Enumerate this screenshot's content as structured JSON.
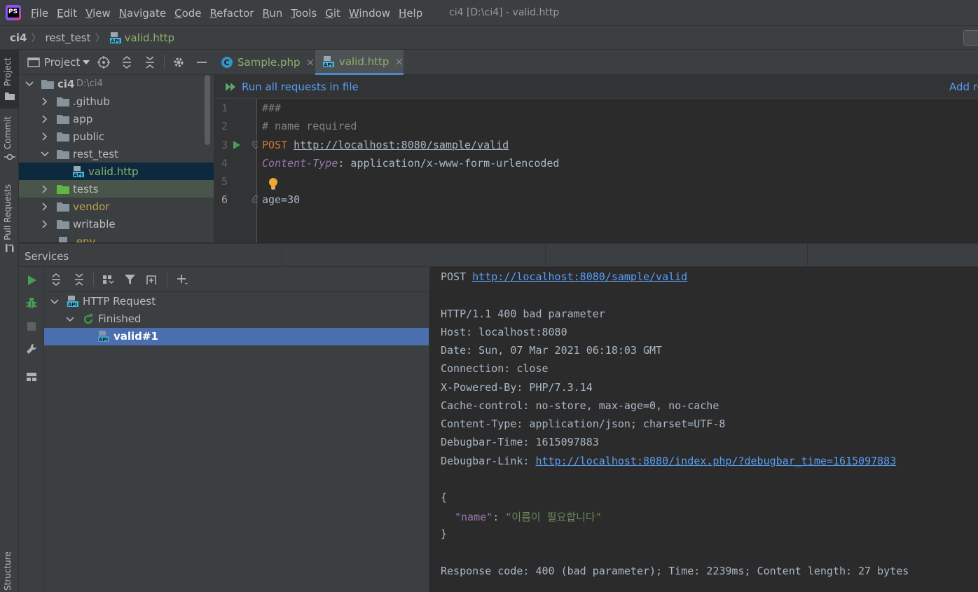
{
  "window": {
    "app_badge": "PS",
    "title": "ci4 [D:\\ci4] - valid.http",
    "menu": [
      {
        "u": "F",
        "rest": "ile"
      },
      {
        "u": "E",
        "rest": "dit"
      },
      {
        "u": "V",
        "rest": "iew"
      },
      {
        "u": "N",
        "rest": "avigate"
      },
      {
        "u": "C",
        "rest": "ode"
      },
      {
        "u": "R",
        "rest": "efactor"
      },
      {
        "u": "R",
        "rest": "un"
      },
      {
        "u": "T",
        "rest": "ools"
      },
      {
        "u": "G",
        "rest": "it"
      },
      {
        "u": "W",
        "rest": "indow"
      },
      {
        "u": "H",
        "rest": "elp"
      }
    ]
  },
  "breadcrumb": [
    "ci4",
    "rest_test",
    "valid.http"
  ],
  "left_tabs": [
    "Project",
    "Commit",
    "Pull Requests",
    "Structure"
  ],
  "project": {
    "title": "Project",
    "root": {
      "name": "ci4",
      "path": "D:\\ci4"
    },
    "items": [
      {
        "name": ".github",
        "color": "#bbbbbb"
      },
      {
        "name": "app",
        "color": "#bbbbbb"
      },
      {
        "name": "public",
        "color": "#bbbbbb"
      },
      {
        "name": "rest_test",
        "color": "#bbbbbb"
      },
      {
        "name": "valid.http",
        "color": "#8bb26b"
      },
      {
        "name": "tests",
        "color": "#9ec37f"
      },
      {
        "name": "vendor",
        "color": "#b8a24a"
      },
      {
        "name": "writable",
        "color": "#bbbbbb"
      },
      {
        "name": ".env",
        "color": "#b8a24a"
      }
    ]
  },
  "editor": {
    "tabs": [
      {
        "label": "Sample.php",
        "close": "×"
      },
      {
        "label": "valid.http",
        "close": "×"
      }
    ],
    "run_all": "Run all requests in file",
    "add_request": "Add re",
    "line_numbers": [
      "1",
      "2",
      "3",
      "4",
      "5",
      "6"
    ],
    "lines": {
      "l1": "###",
      "l2": "# name required",
      "l3_method": "POST",
      "l3_url": "http://localhost:8080/sample/valid",
      "l4_header": "Content-Type",
      "l4_value": ": application/x-www-form-urlencoded",
      "l6": "age=30"
    }
  },
  "services": {
    "title": "Services",
    "tree": {
      "root": "HTTP Request",
      "group": "Finished",
      "item": "valid#1"
    }
  },
  "response": {
    "request_method": "POST",
    "request_url": "http://localhost:8080/sample/valid",
    "status": "HTTP/1.1 400 bad parameter",
    "headers": [
      "Host: localhost:8080",
      "Date: Sun, 07 Mar 2021 06:18:03 GMT",
      "Connection: close",
      "X-Powered-By: PHP/7.3.14",
      "Cache-control: no-store, max-age=0, no-cache",
      "Content-Type: application/json; charset=UTF-8",
      "Debugbar-Time: 1615097883"
    ],
    "debug_link_key": "Debugbar-Link:",
    "debug_link_url": "http://localhost:8080/index.php/?debugbar_time=1615097883",
    "body_open": "{",
    "body_key": "\"name\"",
    "body_colon": ": ",
    "body_value": "\"이름이 필요합니다\"",
    "body_close": "}",
    "summary": "Response code: 400 (bad parameter); Time: 2239ms; Content length: 27 bytes"
  }
}
